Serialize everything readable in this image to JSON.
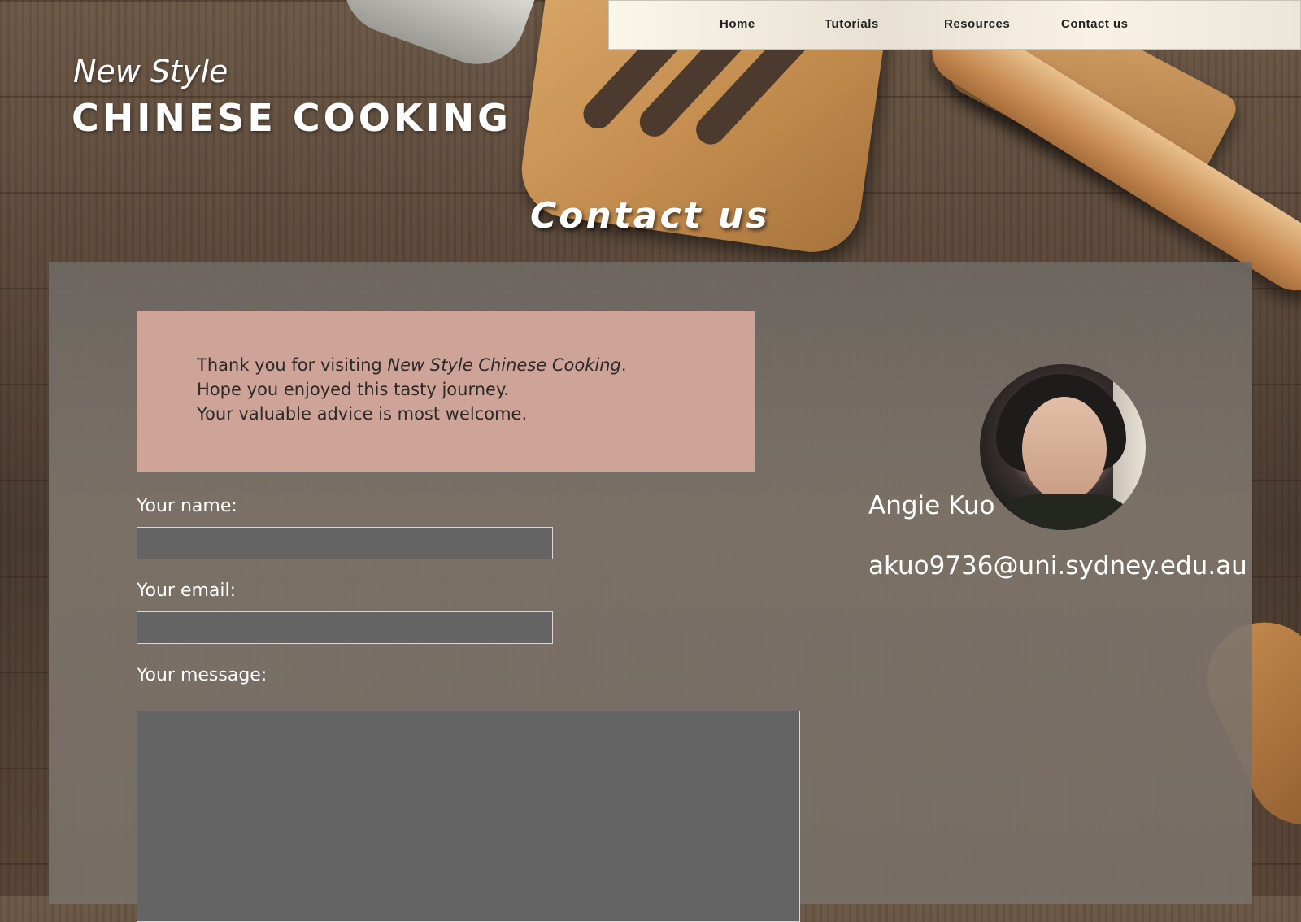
{
  "nav": {
    "items": [
      {
        "label": "Home"
      },
      {
        "label": "Tutorials"
      },
      {
        "label": "Resources"
      },
      {
        "label": "Contact us"
      }
    ]
  },
  "brand": {
    "subtitle": "New Style",
    "title": "CHINESE COOKING"
  },
  "page": {
    "heading": "Contact us"
  },
  "thanks": {
    "line1_prefix": "Thank you for visiting ",
    "line1_emphasis": "New Style Chinese Cooking",
    "line1_suffix": ".",
    "line2": "Hope you enjoyed this tasty journey.",
    "line3": "Your valuable advice is most welcome."
  },
  "form": {
    "name_label": "Your name:",
    "name_value": "",
    "email_label": "Your email:",
    "email_value": "",
    "message_label": "Your message:",
    "message_value": ""
  },
  "contact": {
    "name": "Angie Kuo",
    "email": "akuo9736@uni.sydney.edu.au"
  },
  "colors": {
    "thanks_box": "#cfa498",
    "panel": "#7a7068",
    "field": "#646464"
  }
}
